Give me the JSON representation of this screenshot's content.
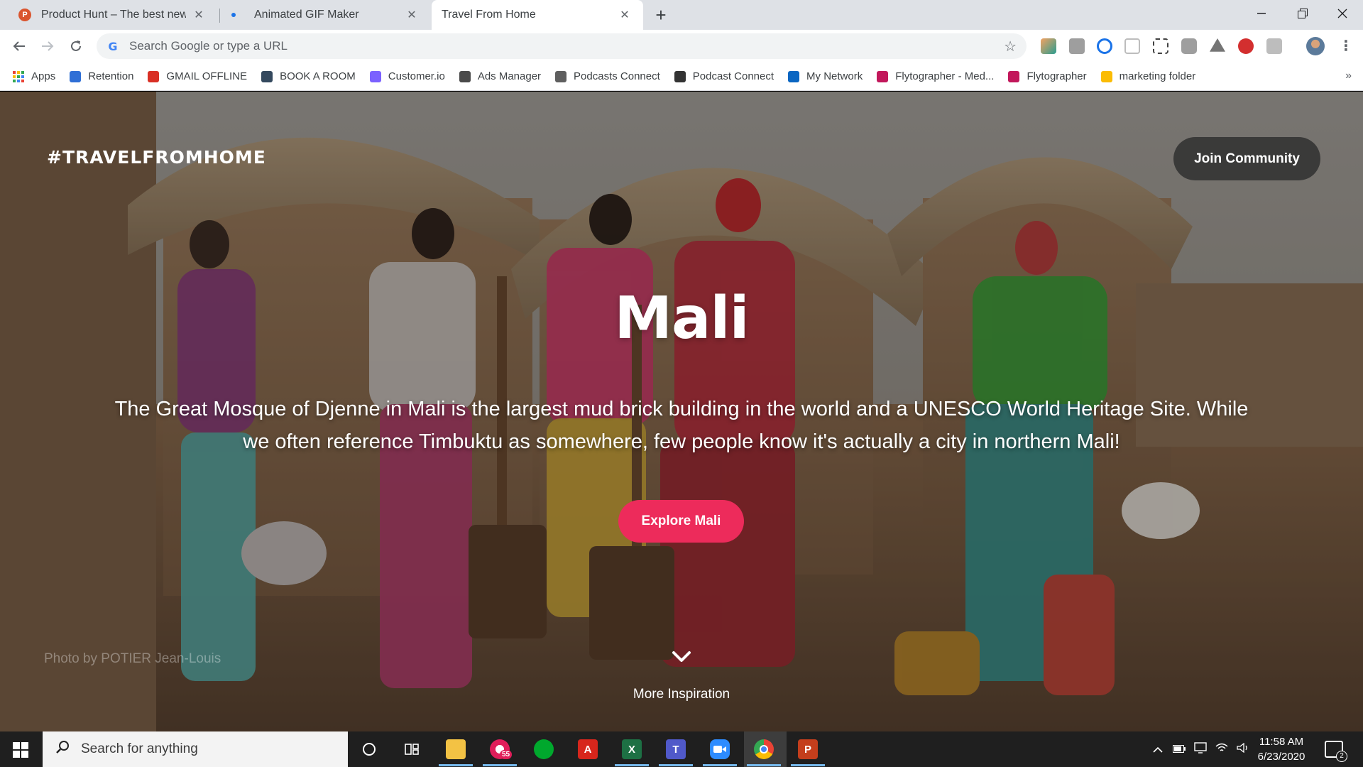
{
  "browser": {
    "tabs": [
      {
        "title": "Product Hunt – The best new products",
        "favicon_color": "#da552f",
        "favicon_letter": "P",
        "active": false
      },
      {
        "title": "Animated GIF Maker",
        "favicon_color": "#1a73e8",
        "active": false
      },
      {
        "title": "Travel From Home",
        "active": true
      }
    ],
    "new_tab_symbol": "+",
    "close_symbol": "✕",
    "omnibox": {
      "placeholder": "Search Google or type a URL",
      "value": ""
    },
    "bookmarks": [
      {
        "label": "Apps",
        "icon": "apps-grid-icon",
        "color": "#4285f4"
      },
      {
        "label": "Retention",
        "icon": "retention-icon",
        "color": "#2f6fd6"
      },
      {
        "label": "GMAIL OFFLINE",
        "icon": "gmail-icon",
        "color": "#d93025"
      },
      {
        "label": "BOOK A ROOM",
        "icon": "book-a-room-icon",
        "color": "#34495e"
      },
      {
        "label": "Customer.io",
        "icon": "customerio-icon",
        "color": "#7b61ff"
      },
      {
        "label": "Ads Manager",
        "icon": "ads-manager-icon",
        "color": "#4a4a4a"
      },
      {
        "label": "Podcasts Connect",
        "icon": "podcasts-icon",
        "color": "#5f5f5f"
      },
      {
        "label": "Podcast Connect",
        "icon": "apple-icon",
        "color": "#333333"
      },
      {
        "label": "My Network",
        "icon": "linkedin-icon",
        "color": "#0a66c2"
      },
      {
        "label": "Flytographer - Med...",
        "icon": "flytographer-icon",
        "color": "#c2185b"
      },
      {
        "label": "Flytographer",
        "icon": "flytographer-icon",
        "color": "#c2185b"
      },
      {
        "label": "marketing folder",
        "icon": "google-drive-icon",
        "color": "#fbbc04"
      }
    ]
  },
  "page": {
    "brand": "#TRAVELFROMHOME",
    "join_label": "Join Community",
    "title": "Mali",
    "description": "The Great Mosque of Djenne in Mali is the largest mud brick building in the world and a UNESCO World Heritage Site. While we often reference Timbuktu as somewhere, few people know it's actually a city in northern Mali!",
    "explore_label": "Explore  Mali",
    "photo_credit": "Photo by POTIER Jean-Louis",
    "more_label": "More Inspiration",
    "accent_color": "#ed2b5b"
  },
  "taskbar": {
    "search_placeholder": "Search for anything",
    "clock_time": "11:58 AM",
    "clock_date": "6/23/2020",
    "notification_count": "2",
    "badge_count": "55"
  }
}
